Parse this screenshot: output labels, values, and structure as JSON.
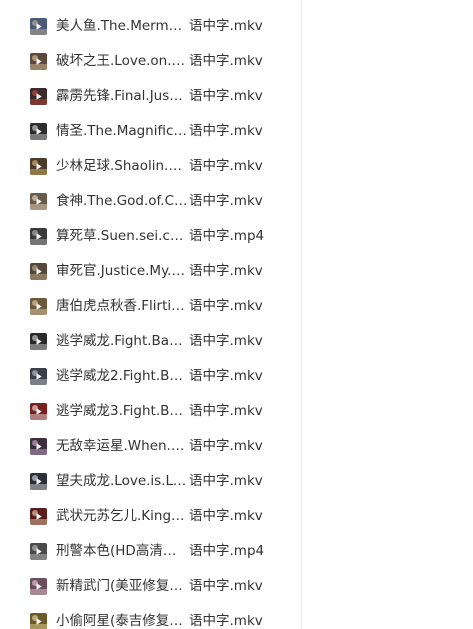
{
  "files": [
    {
      "name": "美人鱼.The.Mermai...",
      "suffix": "语中字.mkv",
      "thumb": "film-thumbnail-icon",
      "tone": "#4a5a78",
      "accent": "#c9b48a"
    },
    {
      "name": "破坏之王.Love.on.D...",
      "suffix": "语中字.mkv",
      "thumb": "film-thumbnail-icon",
      "tone": "#5b4a3c",
      "accent": "#e0c9a0"
    },
    {
      "name": "霹雳先锋.Final.Justic...",
      "suffix": "语中字.mkv",
      "thumb": "film-thumbnail-icon",
      "tone": "#3a2b2b",
      "accent": "#d24a3a"
    },
    {
      "name": "情圣.The.Magnifice...",
      "suffix": "语中字.mkv",
      "thumb": "film-thumbnail-icon",
      "tone": "#2d2d2d",
      "accent": "#d8d8d8"
    },
    {
      "name": "少林足球.Shaolin.So...",
      "suffix": "语中字.mkv",
      "thumb": "film-thumbnail-icon",
      "tone": "#4b3b2b",
      "accent": "#e3c26a"
    },
    {
      "name": "食神.The.God.of.Co...",
      "suffix": "语中字.mkv",
      "thumb": "film-thumbnail-icon",
      "tone": "#6a5a4a",
      "accent": "#f0e2c8"
    },
    {
      "name": "算死草.Suen.sei.cho...",
      "suffix": "语中字.mp4",
      "thumb": "film-thumbnail-icon",
      "tone": "#3a3a3a",
      "accent": "#bdbdbd"
    },
    {
      "name": "审死官.Justice.My.F...",
      "suffix": "语中字.mkv",
      "thumb": "film-thumbnail-icon",
      "tone": "#55473a",
      "accent": "#cdb890"
    },
    {
      "name": "唐伯虎点秋香.Flirtin...",
      "suffix": "语中字.mkv",
      "thumb": "film-thumbnail-icon",
      "tone": "#6b5a3e",
      "accent": "#e9d6a8"
    },
    {
      "name": "逃学威龙.Fight.Back...",
      "suffix": "语中字.mkv",
      "thumb": "film-thumbnail-icon",
      "tone": "#2a2a2a",
      "accent": "#dddddd"
    },
    {
      "name": "逃学威龙2.Fight.Bac...",
      "suffix": "语中字.mkv",
      "thumb": "film-thumbnail-icon",
      "tone": "#3a3f4a",
      "accent": "#c8cdd6"
    },
    {
      "name": "逃学威龙3.Fight.Bac...",
      "suffix": "语中字.mkv",
      "thumb": "film-thumbnail-icon",
      "tone": "#7a1f1f",
      "accent": "#efefef"
    },
    {
      "name": "无敌幸运星.When.F...",
      "suffix": "语中字.mkv",
      "thumb": "film-thumbnail-icon",
      "tone": "#3b2f3f",
      "accent": "#d9b0d0"
    },
    {
      "name": "望夫成龙.Love.is.Lov...",
      "suffix": "语中字.mkv",
      "thumb": "film-thumbnail-icon",
      "tone": "#2b2f3a",
      "accent": "#e6e6e6"
    },
    {
      "name": "武状元苏乞儿.King.o...",
      "suffix": "语中字.mkv",
      "thumb": "film-thumbnail-icon",
      "tone": "#5a1e1e",
      "accent": "#f2d6b0"
    },
    {
      "name": "刑警本色(HD高清修...",
      "suffix": "语中字.mp4",
      "thumb": "film-thumbnail-icon",
      "tone": "#4a4a4a",
      "accent": "#c7c7c7"
    },
    {
      "name": "新精武门(美亚修复)....",
      "suffix": "语中字.mkv",
      "thumb": "film-thumbnail-icon",
      "tone": "#6a4e5a",
      "accent": "#f0d0dc"
    },
    {
      "name": "小偷阿星(泰吉修复)....",
      "suffix": "语中字.mkv",
      "thumb": "film-thumbnail-icon",
      "tone": "#6a5a2a",
      "accent": "#f1e0a0"
    }
  ]
}
